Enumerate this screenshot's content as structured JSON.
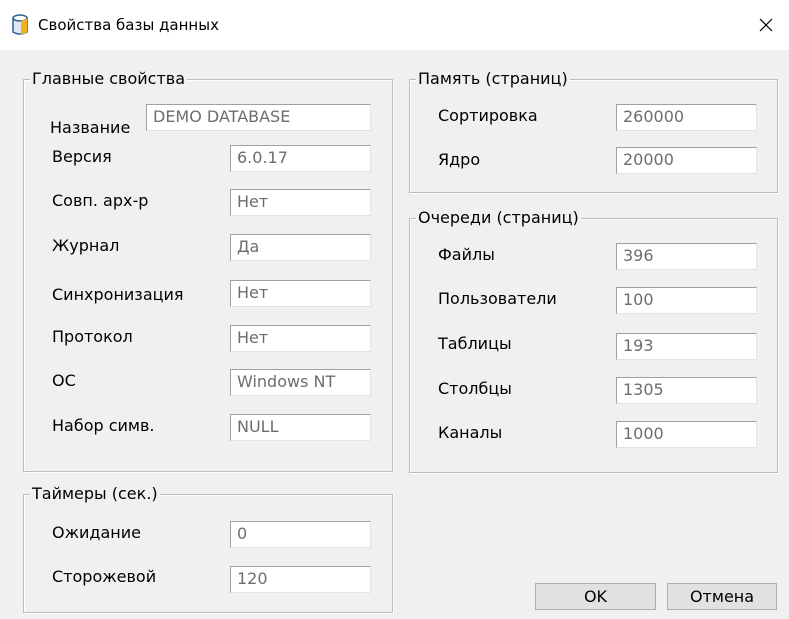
{
  "window": {
    "title": "Свойства базы данных"
  },
  "main_props": {
    "legend": "Главные свойства",
    "name_label": "Название",
    "name_value": "DEMO DATABASE",
    "rows": [
      {
        "label": "Версия",
        "value": "6.0.17"
      },
      {
        "label": "Совп. арх-р",
        "value": "Нет"
      },
      {
        "label": "Журнал",
        "value": "Да"
      },
      {
        "label": "Синхронизация",
        "value": "Нет"
      },
      {
        "label": "Протокол",
        "value": "Нет"
      },
      {
        "label": "ОС",
        "value": "Windows NT"
      },
      {
        "label": "Набор симв.",
        "value": "NULL"
      }
    ]
  },
  "memory": {
    "legend": "Память (страниц)",
    "rows": [
      {
        "label": "Сортировка",
        "value": "260000"
      },
      {
        "label": "Ядро",
        "value": "20000"
      }
    ]
  },
  "queues": {
    "legend": "Очереди (страниц)",
    "rows": [
      {
        "label": "Файлы",
        "value": "396"
      },
      {
        "label": "Пользователи",
        "value": "100"
      },
      {
        "label": "Таблицы",
        "value": "193"
      },
      {
        "label": "Столбцы",
        "value": "1305"
      },
      {
        "label": "Каналы",
        "value": "1000"
      }
    ]
  },
  "timers": {
    "legend": "Таймеры (сек.)",
    "rows": [
      {
        "label": "Ожидание",
        "value": "0"
      },
      {
        "label": "Сторожевой",
        "value": "120"
      }
    ]
  },
  "buttons": {
    "ok": "OK",
    "cancel": "Отмена"
  },
  "icons": {
    "title": "database-icon",
    "close": "close-icon"
  }
}
